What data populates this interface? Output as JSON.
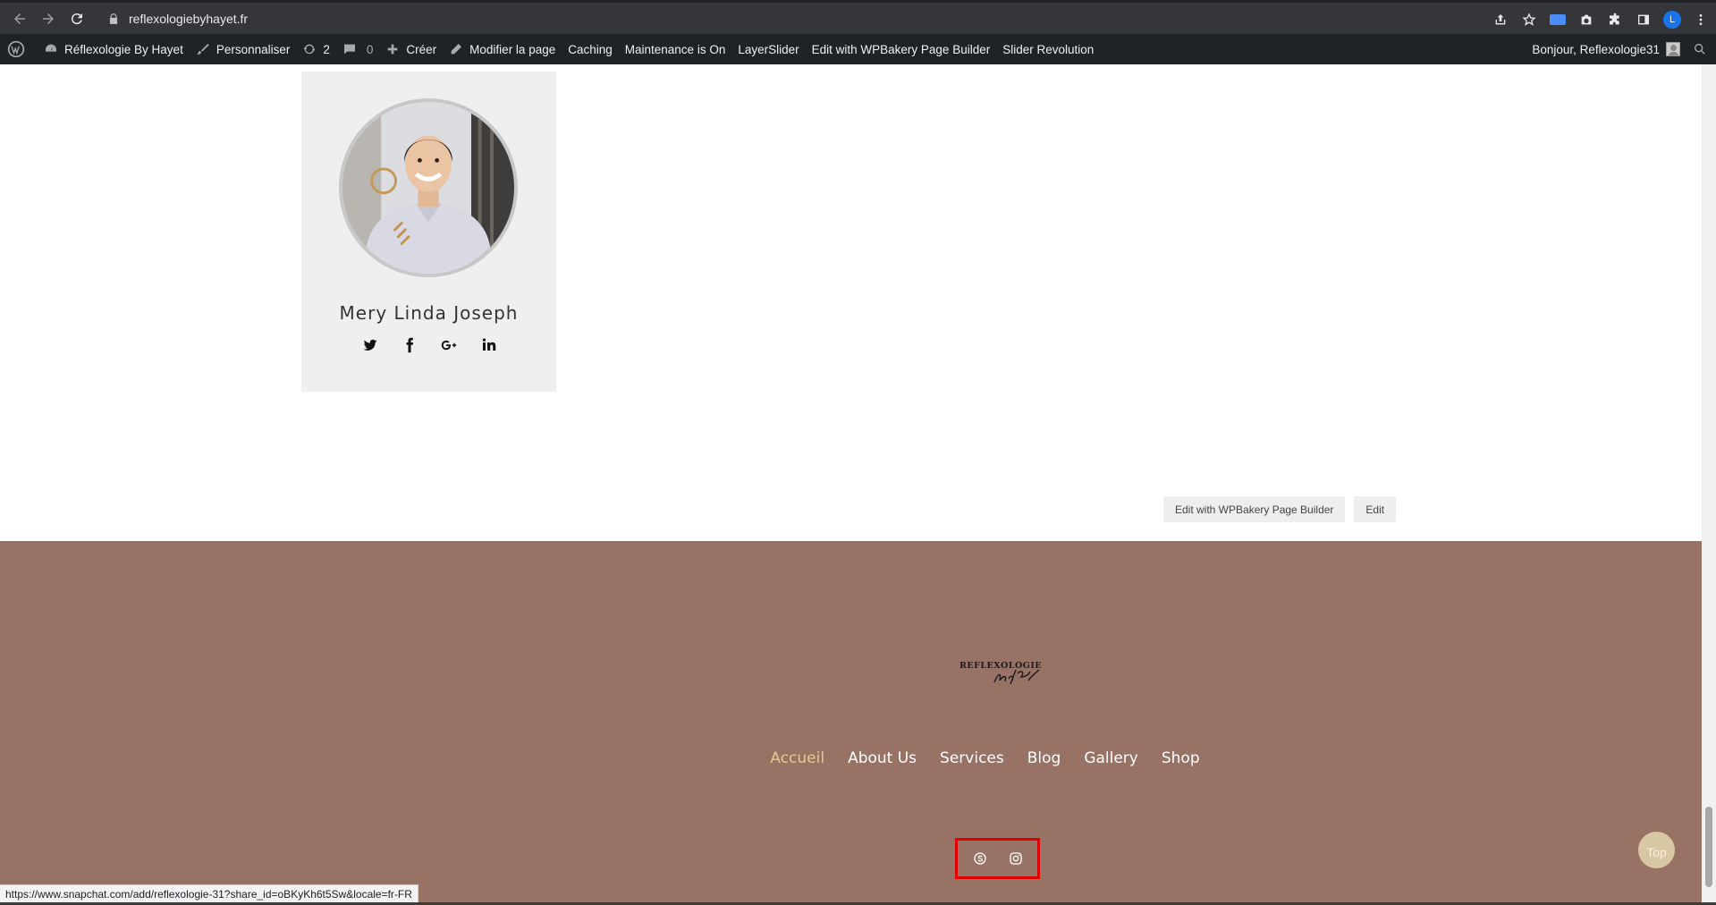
{
  "browser": {
    "url": "reflexologiebyhayet.fr",
    "profile_initial": "L"
  },
  "admin_bar": {
    "site_name": "Réflexologie By Hayet",
    "customize": "Personnaliser",
    "updates_count": "2",
    "comments_count": "0",
    "new": "Créer",
    "edit_page": "Modifier la page",
    "caching": "Caching",
    "maintenance": "Maintenance is On",
    "layerslider": "LayerSlider",
    "wpbakery": "Edit with WPBakery Page Builder",
    "slider_revolution": "Slider Revolution",
    "greeting": "Bonjour, Reflexologie31"
  },
  "team": {
    "name": "Mery Linda Joseph",
    "social": [
      "twitter-icon",
      "facebook-icon",
      "google-plus-icon",
      "linkedin-icon"
    ]
  },
  "edit_buttons": {
    "wpbakery": "Edit with WPBakery Page Builder",
    "edit": "Edit"
  },
  "footer": {
    "logo_alt": "REFLEXOLOGIE By Hayet",
    "nav": [
      "Accueil",
      "About Us",
      "Services",
      "Blog",
      "Gallery",
      "Shop"
    ],
    "social": [
      "skype-icon",
      "instagram-icon"
    ],
    "top_label": "Top"
  },
  "status_bar": {
    "link": "https://www.snapchat.com/add/reflexologie-31?share_id=oBKyKh6t5Sw&locale=fr-FR"
  },
  "colors": {
    "footer_bg": "#987264",
    "nav_active": "#e8c88f",
    "admin_bar": "#1d2327",
    "highlight_box": "#e00000"
  }
}
